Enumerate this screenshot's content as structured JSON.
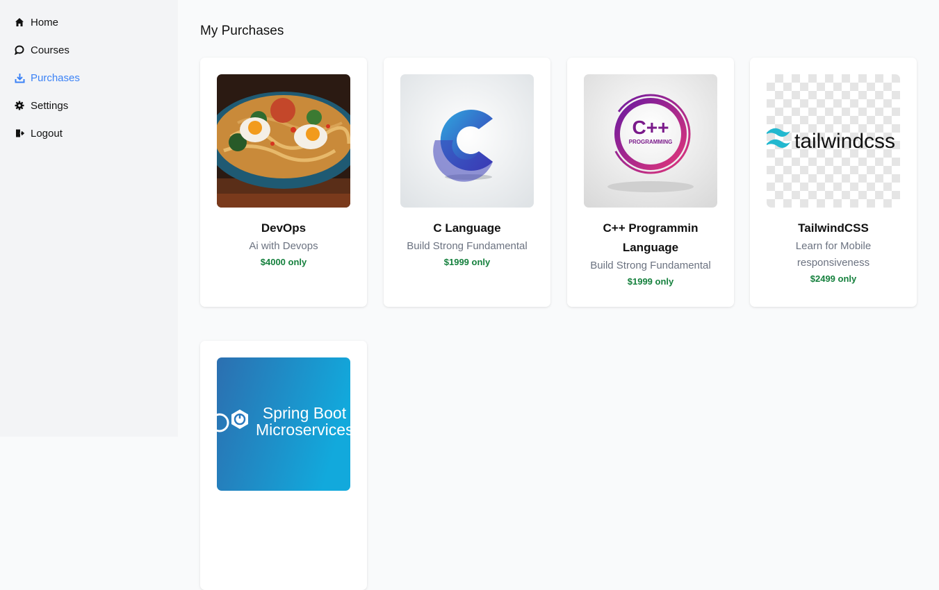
{
  "sidebar": {
    "items": [
      {
        "label": "Home",
        "icon": "home-icon"
      },
      {
        "label": "Courses",
        "icon": "chat-bubble-icon"
      },
      {
        "label": "Purchases",
        "icon": "download-icon",
        "active": true
      },
      {
        "label": "Settings",
        "icon": "gear-icon"
      },
      {
        "label": "Logout",
        "icon": "logout-icon"
      }
    ]
  },
  "main": {
    "title": "My Purchases",
    "courses": [
      {
        "title": "DevOps",
        "description": "Ai with Devops",
        "price": "$4000 only",
        "image": "noodle-bowl-image"
      },
      {
        "title": "C Language",
        "description": "Build Strong Fundamental",
        "price": "$1999 only",
        "image": "c-logo-image"
      },
      {
        "title": "C++ Programmin Language",
        "description": "Build Strong Fundamental",
        "price": "$1999 only",
        "image": "cpp-logo-image",
        "image_text": "C++",
        "image_subtext": "PROGRAMMING"
      },
      {
        "title": "TailwindCSS",
        "description": "Learn for Mobile responsiveness",
        "price": "$2499 only",
        "image": "tailwind-logo-image",
        "image_text": "tailwindcss"
      },
      {
        "image": "spring-boot-image",
        "image_text": "Spring Boot Microservices"
      }
    ]
  },
  "colors": {
    "accent": "#3b82f6",
    "price": "#15803d",
    "sidebar_bg": "#f3f4f6",
    "page_bg": "#f9fafb"
  }
}
